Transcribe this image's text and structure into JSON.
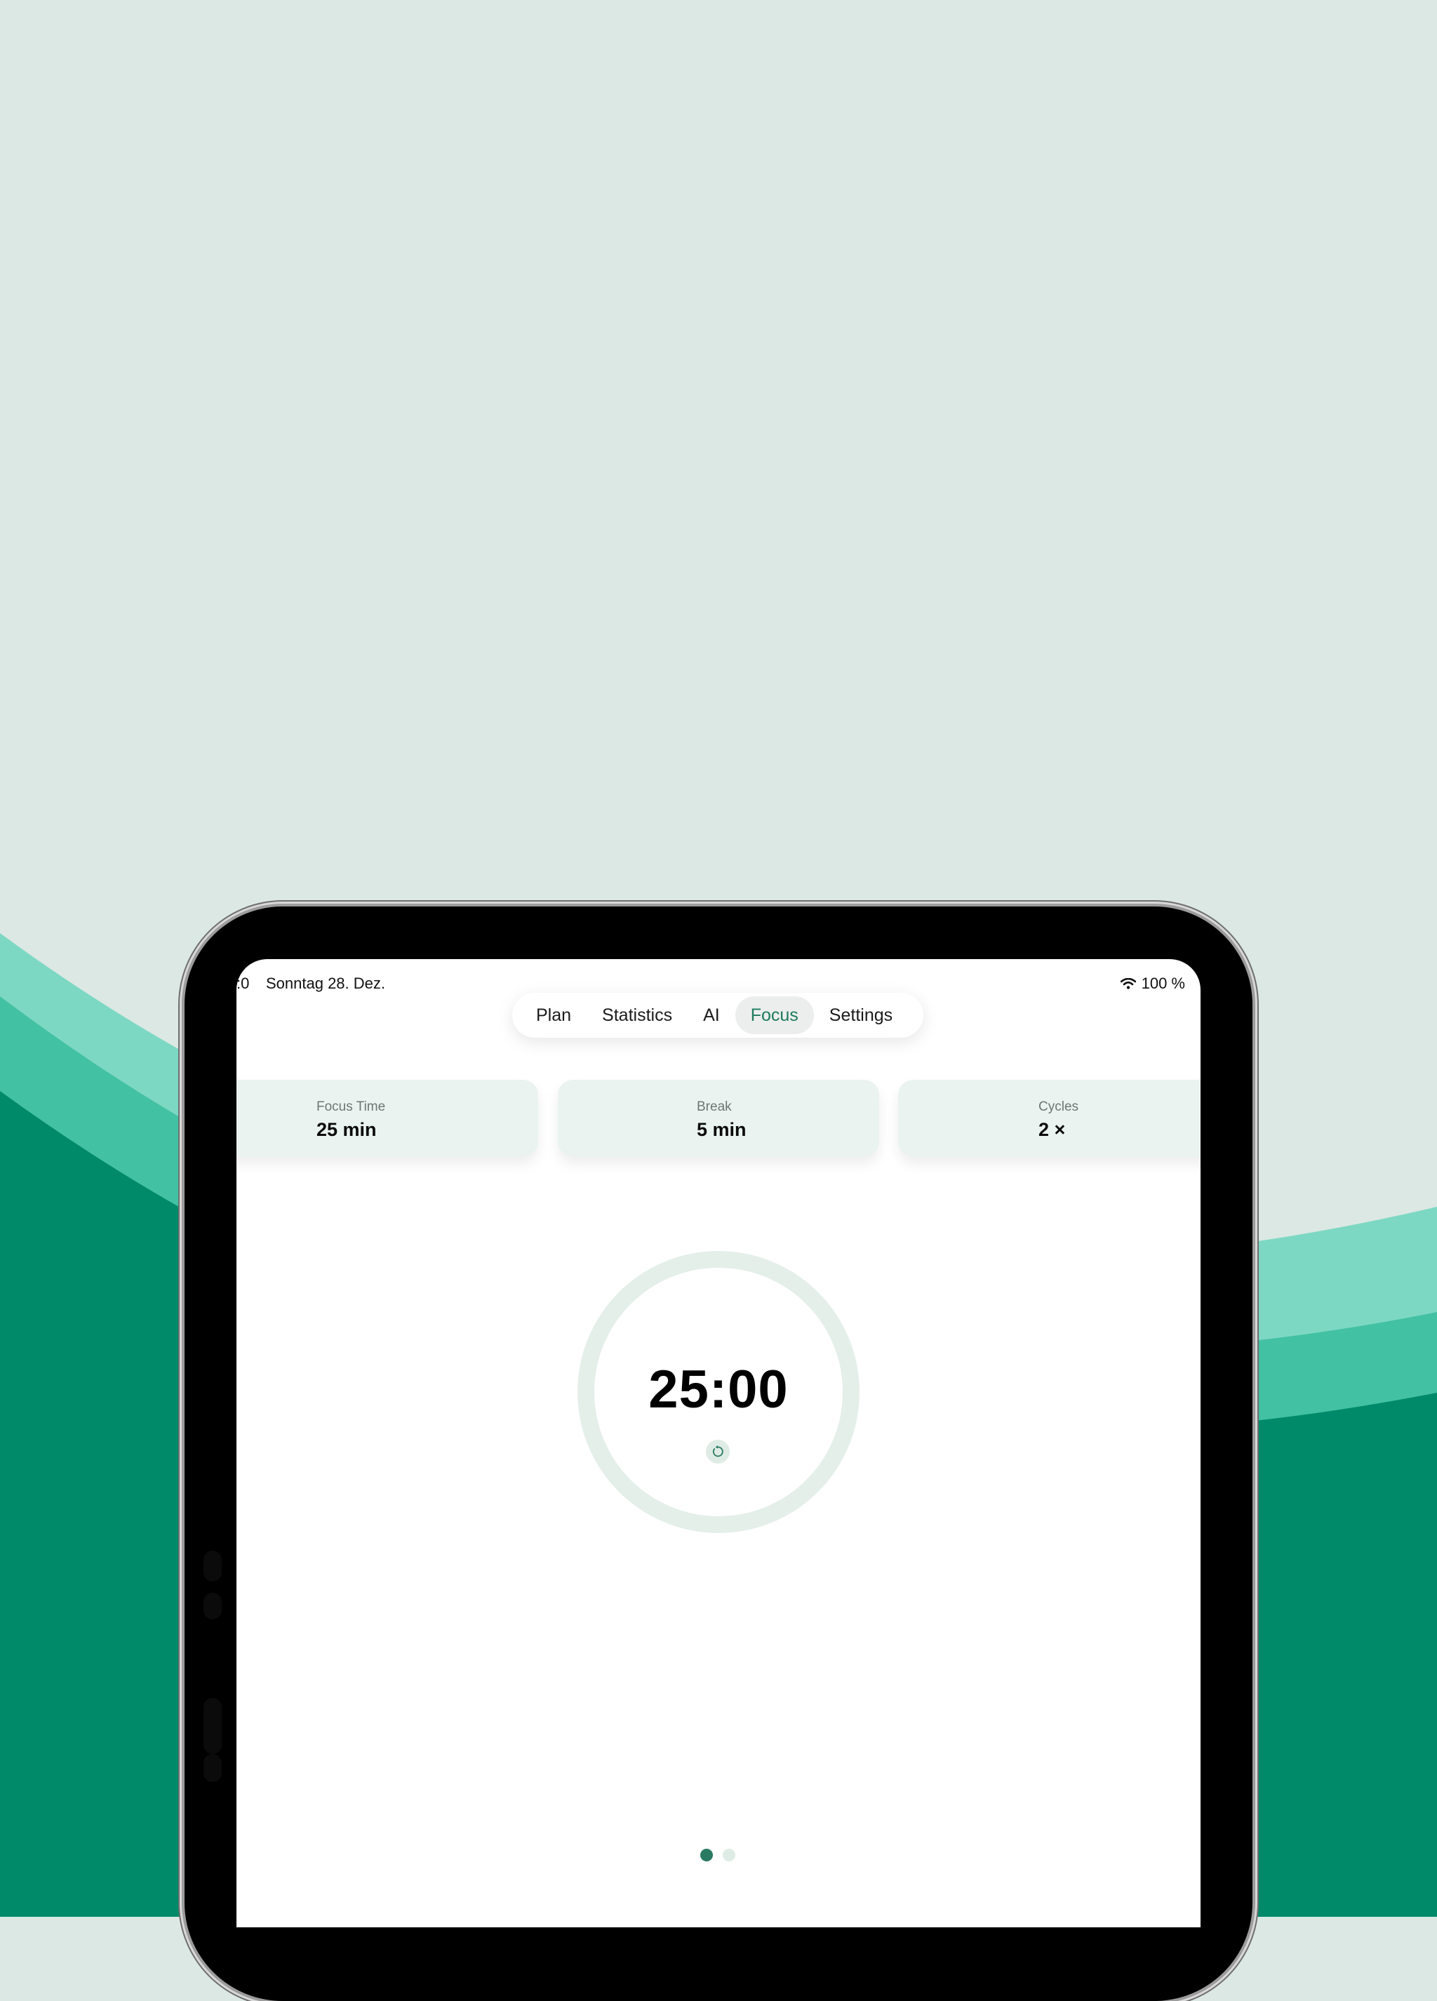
{
  "status_bar": {
    "time": ":0",
    "date": "Sonntag 28. Dez.",
    "battery": "100 %"
  },
  "tabs": [
    {
      "label": "Plan",
      "active": false
    },
    {
      "label": "Statistics",
      "active": false
    },
    {
      "label": "AI",
      "active": false
    },
    {
      "label": "Focus",
      "active": true
    },
    {
      "label": "Settings",
      "active": false
    }
  ],
  "cards": [
    {
      "label": "Focus Time",
      "value": "25 min"
    },
    {
      "label": "Break",
      "value": "5 min"
    },
    {
      "label": "Cycles",
      "value": "2 ×"
    }
  ],
  "timer": {
    "display": "25:00",
    "progress": 0
  },
  "pager": {
    "total": 2,
    "current": 1
  },
  "colors": {
    "accent": "#1d7b5d",
    "background": "#dce8e3",
    "wave_light": "#7dd8c3",
    "wave_mid": "#43c1a3",
    "wave_dark": "#008a69",
    "card_bg": "#eaf3ef",
    "ring": "#e5efea"
  },
  "icons": {
    "wifi": "wifi-icon",
    "reset": "reset-icon"
  }
}
